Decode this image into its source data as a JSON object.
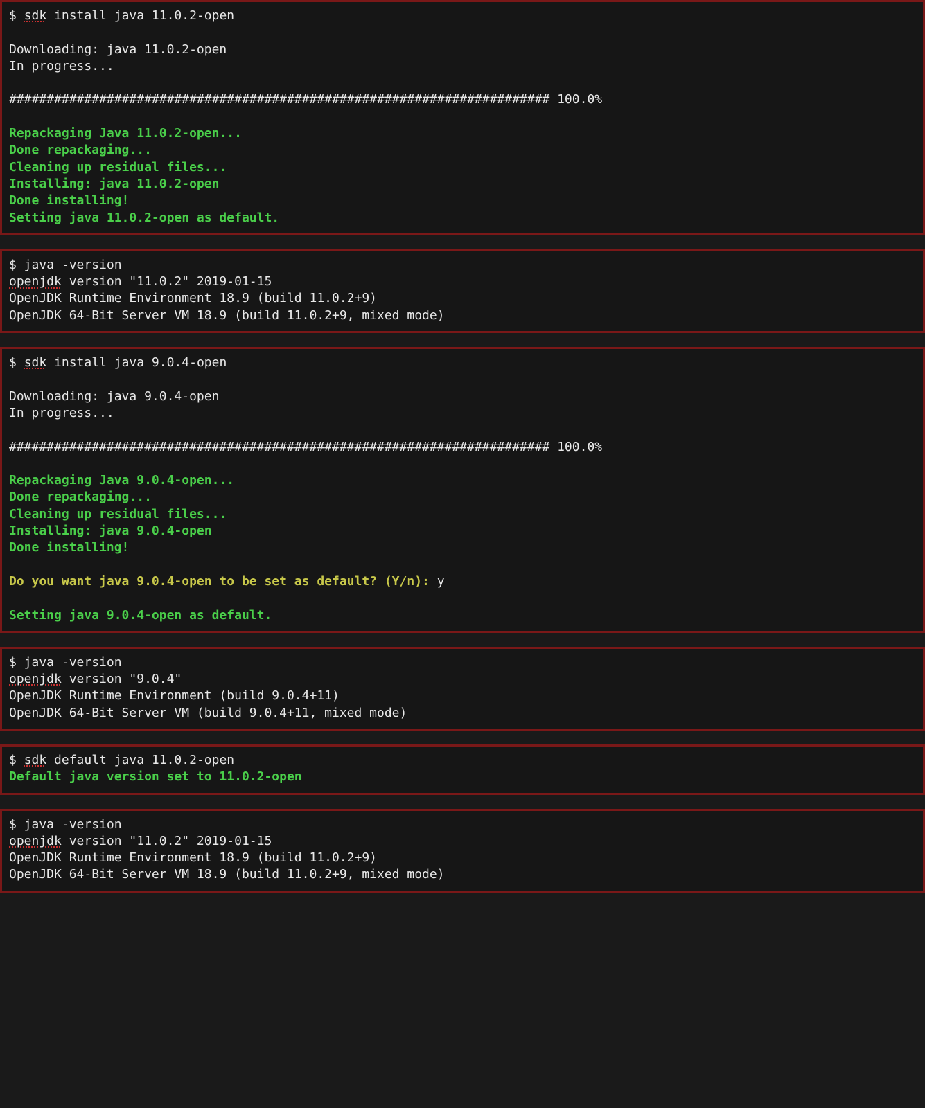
{
  "blocks": [
    {
      "id": "install-java11",
      "lines": [
        {
          "cls": "white",
          "segments": [
            {
              "t": "$ "
            },
            {
              "t": "sdk",
              "spell": true
            },
            {
              "t": " install java 11.0.2-open"
            }
          ]
        },
        {
          "cls": "blank"
        },
        {
          "cls": "white",
          "segments": [
            {
              "t": "Downloading: java 11.0.2-open"
            }
          ]
        },
        {
          "cls": "white",
          "segments": [
            {
              "t": "In progress..."
            }
          ]
        },
        {
          "cls": "blank"
        },
        {
          "cls": "white",
          "segments": [
            {
              "t": "######################################################################## 100.0%"
            }
          ]
        },
        {
          "cls": "blank"
        },
        {
          "cls": "green",
          "segments": [
            {
              "t": "Repackaging Java 11.0.2-open..."
            }
          ]
        },
        {
          "cls": "green",
          "segments": [
            {
              "t": "Done repackaging..."
            }
          ]
        },
        {
          "cls": "green",
          "segments": [
            {
              "t": "Cleaning up residual files..."
            }
          ]
        },
        {
          "cls": "green",
          "segments": [
            {
              "t": "Installing: java 11.0.2-open"
            }
          ]
        },
        {
          "cls": "green",
          "segments": [
            {
              "t": "Done installing!"
            }
          ]
        },
        {
          "cls": "green",
          "segments": [
            {
              "t": "Setting java 11.0.2-open as default."
            }
          ]
        }
      ]
    },
    {
      "id": "java-version-11-first",
      "lines": [
        {
          "cls": "white",
          "segments": [
            {
              "t": "$ java -version"
            }
          ]
        },
        {
          "cls": "white",
          "segments": [
            {
              "t": "openjdk",
              "spell": true
            },
            {
              "t": " version \"11.0.2\" 2019-01-15"
            }
          ]
        },
        {
          "cls": "white",
          "segments": [
            {
              "t": "OpenJDK Runtime Environment 18.9 (build 11.0.2+9)"
            }
          ]
        },
        {
          "cls": "white",
          "segments": [
            {
              "t": "OpenJDK 64-Bit Server VM 18.9 (build 11.0.2+9, mixed mode)"
            }
          ]
        }
      ]
    },
    {
      "id": "install-java9",
      "lines": [
        {
          "cls": "white",
          "segments": [
            {
              "t": "$ "
            },
            {
              "t": "sdk",
              "spell": true
            },
            {
              "t": " install java 9.0.4-open"
            }
          ]
        },
        {
          "cls": "blank"
        },
        {
          "cls": "white",
          "segments": [
            {
              "t": "Downloading: java 9.0.4-open"
            }
          ]
        },
        {
          "cls": "white",
          "segments": [
            {
              "t": "In progress..."
            }
          ]
        },
        {
          "cls": "blank"
        },
        {
          "cls": "white",
          "segments": [
            {
              "t": "######################################################################## 100.0%"
            }
          ]
        },
        {
          "cls": "blank"
        },
        {
          "cls": "green",
          "segments": [
            {
              "t": "Repackaging Java 9.0.4-open..."
            }
          ]
        },
        {
          "cls": "green",
          "segments": [
            {
              "t": "Done repackaging..."
            }
          ]
        },
        {
          "cls": "green",
          "segments": [
            {
              "t": "Cleaning up residual files..."
            }
          ]
        },
        {
          "cls": "green",
          "segments": [
            {
              "t": "Installing: java 9.0.4-open"
            }
          ]
        },
        {
          "cls": "green",
          "segments": [
            {
              "t": "Done installing!"
            }
          ]
        },
        {
          "cls": "blank"
        },
        {
          "cls": "mixed",
          "segments": [
            {
              "t": "Do you want java 9.0.4-open to be set as default? (Y/n): ",
              "cls": "yellow"
            },
            {
              "t": "y",
              "cls": "white"
            }
          ]
        },
        {
          "cls": "blank"
        },
        {
          "cls": "green",
          "segments": [
            {
              "t": "Setting java 9.0.4-open as default."
            }
          ]
        }
      ]
    },
    {
      "id": "java-version-9",
      "lines": [
        {
          "cls": "white",
          "segments": [
            {
              "t": "$ java -version"
            }
          ]
        },
        {
          "cls": "white",
          "segments": [
            {
              "t": "openjdk",
              "spell": true
            },
            {
              "t": " version \"9.0.4\""
            }
          ]
        },
        {
          "cls": "white",
          "segments": [
            {
              "t": "OpenJDK Runtime Environment (build 9.0.4+11)"
            }
          ]
        },
        {
          "cls": "white",
          "segments": [
            {
              "t": "OpenJDK 64-Bit Server VM (build 9.0.4+11, mixed mode)"
            }
          ]
        }
      ]
    },
    {
      "id": "default-java11",
      "lines": [
        {
          "cls": "white",
          "segments": [
            {
              "t": "$ "
            },
            {
              "t": "sdk",
              "spell": true
            },
            {
              "t": " default java 11.0.2-open"
            }
          ]
        },
        {
          "cls": "green",
          "segments": [
            {
              "t": "Default java version set to 11.0.2-open"
            }
          ]
        }
      ]
    },
    {
      "id": "java-version-11-second",
      "lines": [
        {
          "cls": "white",
          "segments": [
            {
              "t": "$ java -version"
            }
          ]
        },
        {
          "cls": "white",
          "segments": [
            {
              "t": "openjdk",
              "spell": true
            },
            {
              "t": " version \"11.0.2\" 2019-01-15"
            }
          ]
        },
        {
          "cls": "white",
          "segments": [
            {
              "t": "OpenJDK Runtime Environment 18.9 (build 11.0.2+9)"
            }
          ]
        },
        {
          "cls": "white",
          "segments": [
            {
              "t": "OpenJDK 64-Bit Server VM 18.9 (build 11.0.2+9, mixed mode)"
            }
          ]
        }
      ]
    }
  ]
}
